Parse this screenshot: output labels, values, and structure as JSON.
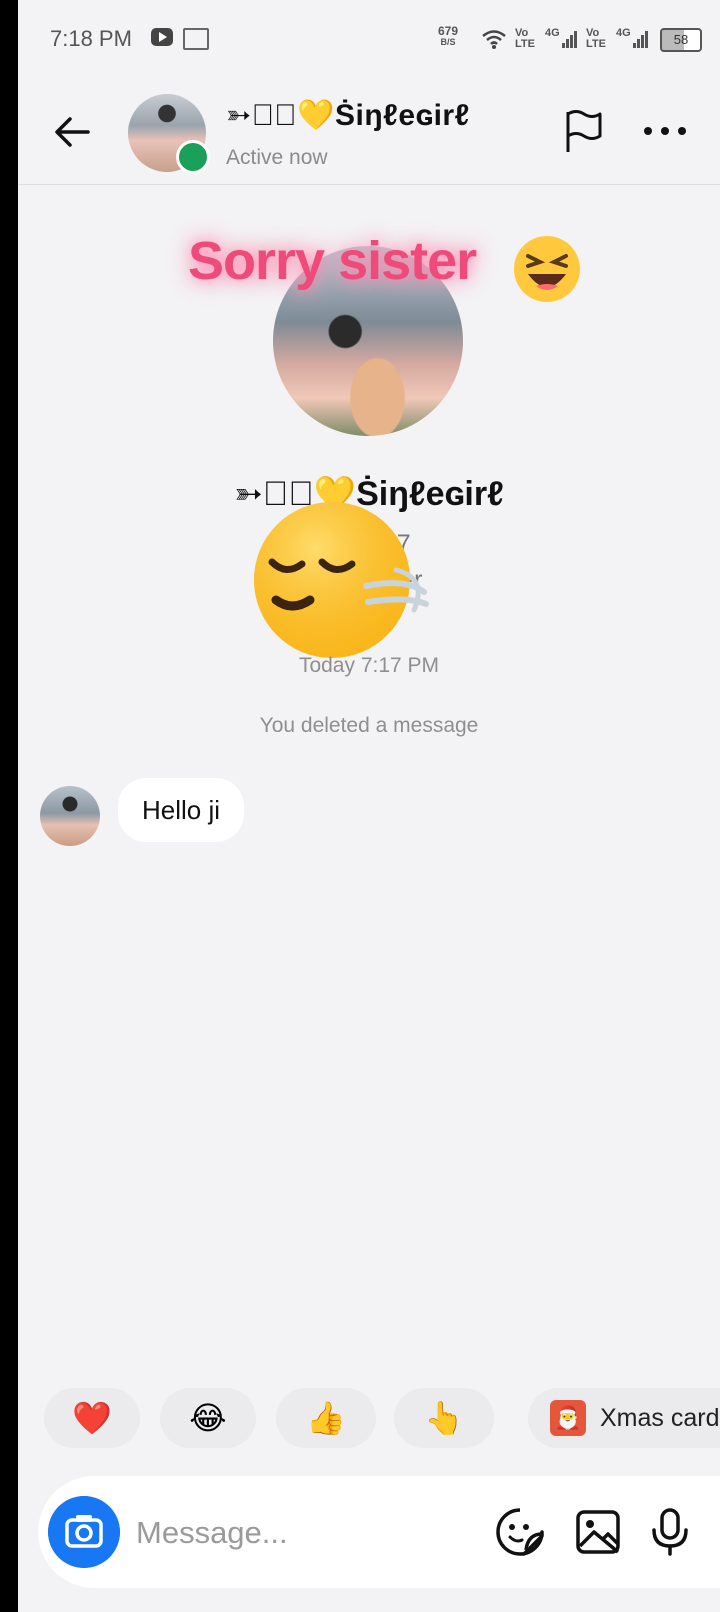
{
  "status_bar": {
    "time": "7:18 PM",
    "net_speed_value": "679",
    "net_speed_unit": "B/S",
    "sim1_label": "Vo\nLTE",
    "sim1_type": "4G",
    "sim2_label": "Vo\nLTE",
    "sim2_type": "4G",
    "battery": "58",
    "icons": [
      "youtube-icon",
      "calendar-icon",
      "wifi-icon",
      "signal-icon",
      "battery-icon"
    ]
  },
  "header": {
    "name": "➳✫⃟💛Ṡiŋℓeɢirℓ",
    "status": "Active now",
    "icons": [
      "back-arrow-icon",
      "flag-icon",
      "more-icon"
    ],
    "online_color": "#1ba05a"
  },
  "sticker": {
    "text": "Sorry sister",
    "emoji": "laughing-face-icon",
    "text_color": "#ee4a7a"
  },
  "profile": {
    "name": "➳✫⃟💛Ṡiŋℓeɢirℓ",
    "handle": "dhd557",
    "stats": "1 follower"
  },
  "chat": {
    "datestamp": "Today 7:17 PM",
    "deleted_notice": "You deleted a message",
    "messages": [
      {
        "text": "Hello ji"
      }
    ]
  },
  "quick_replies": {
    "items": [
      "❤️",
      "😂",
      "👍",
      "👆"
    ],
    "xmas_label": "Xmas card"
  },
  "composer": {
    "placeholder": "Message...",
    "icons": [
      "camera-icon",
      "sticker-icon",
      "gallery-icon",
      "microphone-icon"
    ],
    "camera_color": "#1877f2"
  }
}
